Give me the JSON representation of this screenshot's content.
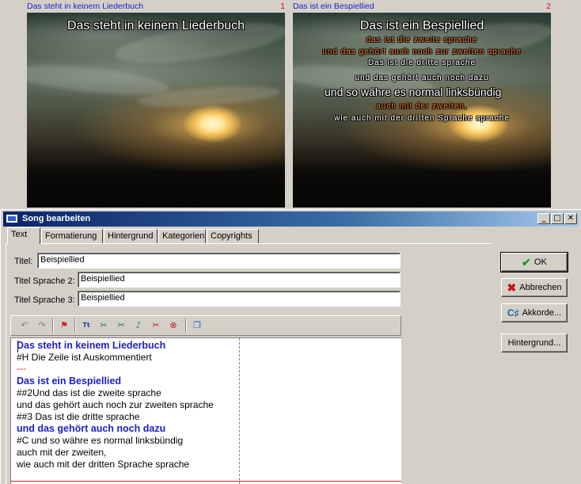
{
  "previews": [
    {
      "title": "Das steht in keinem Liederbuch",
      "number": "1",
      "lines": [
        {
          "text": "Das steht in keinem Liederbuch",
          "style": "big"
        }
      ]
    },
    {
      "title": "Das ist ein Bespiellied",
      "number": "2",
      "lines": [
        {
          "text": "Das ist ein Bespiellied",
          "style": "big"
        },
        {
          "text": "das ist die zweite sprache",
          "style": "orange"
        },
        {
          "text": "und das gehört auch noch zur zweiten sprache",
          "style": "orange"
        },
        {
          "text": "Das ist die dritte sprache",
          "style": "white"
        },
        {
          "text": "und das gehört auch noch dazu",
          "style": "white"
        },
        {
          "text": "und so währe es normal linksbündig",
          "style": "big"
        },
        {
          "text": "auch mit der zweiten,",
          "style": "orange"
        },
        {
          "text": "wie auch mit der dritten Sprache sprache",
          "style": "white"
        }
      ]
    }
  ],
  "dialog": {
    "title": "Song bearbeiten",
    "window_buttons": {
      "minimize": "_",
      "maximize": "□",
      "close": "✕"
    },
    "tabs": [
      "Text",
      "Formatierung",
      "Hintergrund",
      "Kategorien",
      "Copyrights"
    ],
    "active_tab": "Text",
    "fields": {
      "titel_label": "Titel:",
      "titel_value": "Beispiellied",
      "titel2_label": "Titel Sprache 2:",
      "titel2_value": "Beispiellied",
      "titel3_label": "Titel Sprache 3:",
      "titel3_value": "Beispiellied"
    },
    "toolbar_icons": [
      "undo-icon",
      "redo-icon",
      "insert-flag-icon",
      "insert-title-icon",
      "transpose-icon",
      "cut-note-icon",
      "note-icon",
      "cut-flag-icon",
      "cut-remove-icon",
      "copy-icon"
    ],
    "editor_lines": [
      {
        "text": "Das steht in keinem Liederbuch",
        "style": "blue"
      },
      {
        "text": "#H Die Zeile ist Auskommentiert",
        "style": "normal"
      },
      {
        "text": "---",
        "style": "red"
      },
      {
        "text": "Das ist ein Bespiellied",
        "style": "blue"
      },
      {
        "text": "##2Und das ist die zweite sprache",
        "style": "normal"
      },
      {
        "text": "und das gehört auch noch zur zweiten sprache",
        "style": "normal"
      },
      {
        "text": "##3 Das ist die dritte sprache",
        "style": "normal"
      },
      {
        "text": "und das gehört auch noch dazu",
        "style": "blue"
      },
      {
        "text": "#C und so währe es normal linksbündig",
        "style": "normal"
      },
      {
        "text": "auch mit der zweiten,",
        "style": "normal"
      },
      {
        "text": "wie auch mit der dritten Sprache sprache",
        "style": "normal"
      }
    ],
    "buttons": {
      "ok": "OK",
      "cancel": "Abbrechen",
      "chords": "Akkorde...",
      "background": "Hintergrund..."
    },
    "colors": {
      "accent_blue": "#1d1dc8",
      "separator_red": "#e02020",
      "title_gradient_start": "#0a246a",
      "title_gradient_end": "#a6caf0"
    }
  }
}
